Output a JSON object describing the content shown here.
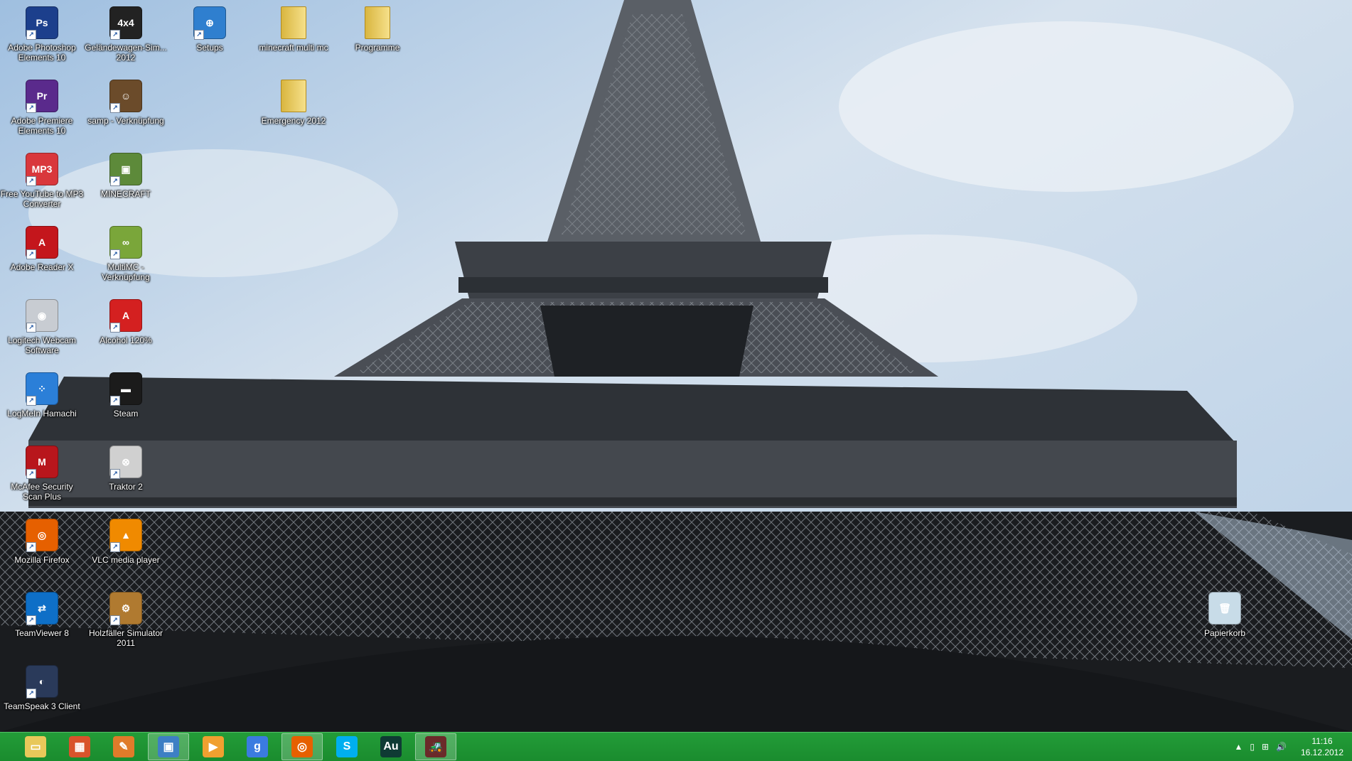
{
  "desktop": {
    "icons": [
      {
        "label": "Adobe Photoshop Elements 10",
        "icon": "photoshop-elements-icon",
        "color": "#1c3f8c",
        "glyph": "Ps"
      },
      {
        "label": "Geländewagen-Sim... 2012",
        "icon": "offroad-simulator-icon",
        "color": "#222222",
        "glyph": "4x4"
      },
      {
        "label": "Setups",
        "icon": "setup-globe-icon",
        "color": "#2f7fcf",
        "glyph": "⊕"
      },
      {
        "label": "minecraft multi mc",
        "icon": "folder-icon",
        "color": "#e8c85a",
        "glyph": ""
      },
      {
        "label": "Programme",
        "icon": "folder-icon",
        "color": "#e8c85a",
        "glyph": ""
      },
      {
        "label": "Adobe Premiere Elements 10",
        "icon": "premiere-elements-icon",
        "color": "#5a2a8c",
        "glyph": "Pr"
      },
      {
        "label": "samp - Verknüpfung",
        "icon": "samp-icon",
        "color": "#6b4b2a",
        "glyph": "☺"
      },
      {
        "label": "Emergency 2012",
        "icon": "folder-icon",
        "color": "#e8c85a",
        "glyph": ""
      },
      {
        "label": "Free YouTube to MP3 Converter",
        "icon": "youtube-mp3-icon",
        "color": "#d9373c",
        "glyph": "MP3"
      },
      {
        "label": "MINECRAFT",
        "icon": "minecraft-icon",
        "color": "#5d8a3a",
        "glyph": "▣"
      },
      {
        "label": "Adobe Reader X",
        "icon": "adobe-reader-icon",
        "color": "#c4161c",
        "glyph": "A"
      },
      {
        "label": "MultiMC - Verknüpfung",
        "icon": "multimc-icon",
        "color": "#7aa63a",
        "glyph": "∞"
      },
      {
        "label": "Logitech Webcam Software",
        "icon": "webcam-icon",
        "color": "#c8ccd2",
        "glyph": "◉"
      },
      {
        "label": "Alcohol 120%",
        "icon": "alcohol-icon",
        "color": "#d42020",
        "glyph": "A"
      },
      {
        "label": "LogMeIn Hamachi",
        "icon": "hamachi-icon",
        "color": "#2b7fd8",
        "glyph": "⁘"
      },
      {
        "label": "Steam",
        "icon": "steam-icon",
        "color": "#1b1b1b",
        "glyph": "▬"
      },
      {
        "label": "McAfee Security Scan Plus",
        "icon": "mcafee-icon",
        "color": "#b8161c",
        "glyph": "M"
      },
      {
        "label": "Traktor 2",
        "icon": "traktor-icon",
        "color": "#d0d0d0",
        "glyph": "⊗"
      },
      {
        "label": "Mozilla Firefox",
        "icon": "firefox-icon",
        "color": "#e66000",
        "glyph": "◎"
      },
      {
        "label": "VLC media player",
        "icon": "vlc-icon",
        "color": "#f08a00",
        "glyph": "▲"
      },
      {
        "label": "TeamViewer 8",
        "icon": "teamviewer-icon",
        "color": "#0e6fc7",
        "glyph": "⇄"
      },
      {
        "label": "Holzfäller Simulator 2011",
        "icon": "lumberjack-simulator-icon",
        "color": "#b07a30",
        "glyph": "⚙"
      },
      {
        "label": "TeamSpeak 3 Client",
        "icon": "teamspeak-icon",
        "color": "#2a3a5a",
        "glyph": "◐"
      },
      {
        "label": "Papierkorb",
        "icon": "recycle-bin-icon",
        "color": "#c8dce8",
        "glyph": "🗑"
      }
    ]
  },
  "taskbar": {
    "buttons": [
      {
        "name": "file-explorer",
        "icon": "folder-icon",
        "color": "#e8c85a",
        "glyph": "▭",
        "active": false
      },
      {
        "name": "office",
        "icon": "office-icon",
        "color": "#d9532b",
        "glyph": "▦",
        "active": false
      },
      {
        "name": "utility",
        "icon": "tools-icon",
        "color": "#e07b2a",
        "glyph": "✎",
        "active": false
      },
      {
        "name": "desktop",
        "icon": "monitor-icon",
        "color": "#3d7fc4",
        "glyph": "▣",
        "active": true
      },
      {
        "name": "media-player",
        "icon": "media-player-icon",
        "color": "#f0a030",
        "glyph": "▶",
        "active": false
      },
      {
        "name": "google",
        "icon": "google-icon",
        "color": "#3b7be0",
        "glyph": "g",
        "active": false
      },
      {
        "name": "firefox",
        "icon": "firefox-icon",
        "color": "#e66000",
        "glyph": "◎",
        "active": true
      },
      {
        "name": "skype",
        "icon": "skype-icon",
        "color": "#00aff0",
        "glyph": "S",
        "active": false
      },
      {
        "name": "audition",
        "icon": "audition-icon",
        "color": "#0f3b34",
        "glyph": "Au",
        "active": false
      },
      {
        "name": "farming-simulator",
        "icon": "tractor-icon",
        "color": "#6b2a2a",
        "glyph": "🚜",
        "active": true
      }
    ],
    "tray": {
      "overflow": "▲",
      "icons": [
        "▯",
        "⊞",
        "🔊"
      ],
      "time": "11:16",
      "date": "16.12.2012"
    }
  },
  "colors": {
    "taskbar": "#1f9433",
    "sky": "#c8d9ec"
  }
}
